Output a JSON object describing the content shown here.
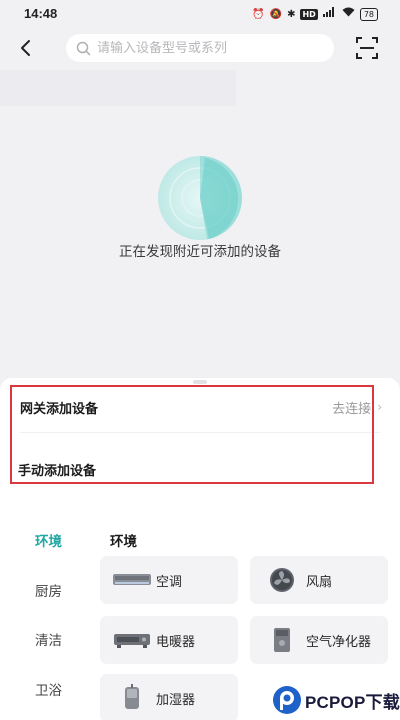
{
  "status_bar": {
    "time": "14:48",
    "hd_label": "HD",
    "battery": "78"
  },
  "top_bar": {
    "search_placeholder": "请输入设备型号或系列"
  },
  "discovery": {
    "status_text": "正在发现附近可添加的设备"
  },
  "add_options": {
    "gateway_label": "网关添加设备",
    "gateway_action": "去连接",
    "manual_label": "手动添加设备"
  },
  "categories": [
    "环境",
    "厨房",
    "清洁",
    "卫浴"
  ],
  "active_category": "环境",
  "section_title": "环境",
  "devices": [
    {
      "label": "空调",
      "icon": "air-conditioner-icon"
    },
    {
      "label": "风扇",
      "icon": "fan-icon"
    },
    {
      "label": "电暖器",
      "icon": "heater-icon"
    },
    {
      "label": "空气净化器",
      "icon": "air-purifier-icon"
    },
    {
      "label": "加湿器",
      "icon": "humidifier-icon"
    }
  ],
  "watermark": {
    "brand": "PCPOP下载"
  },
  "colors": {
    "accent": "#1fa7a3",
    "highlight": "#d9383f",
    "background": "#f1f1f4"
  }
}
